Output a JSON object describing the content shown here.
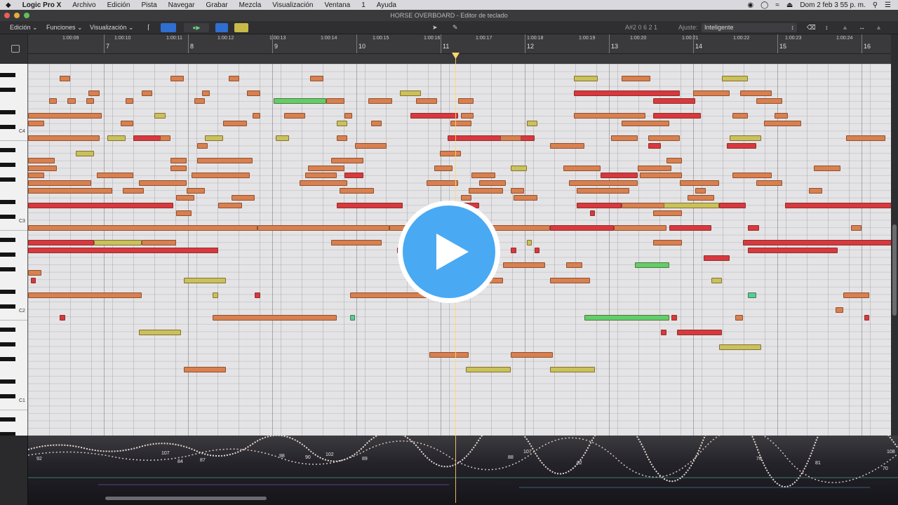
{
  "menubar": {
    "apple": "",
    "app": "Logic Pro X",
    "items": [
      "Archivo",
      "Edición",
      "Pista",
      "Navegar",
      "Grabar",
      "Mezcla",
      "Visualización",
      "Ventana",
      "1",
      "Ayuda"
    ],
    "datetime": "Dom 2 feb  3 55 p. m."
  },
  "window": {
    "title": "HORSE OVERBOARD - Editor de teclado"
  },
  "toolbar": {
    "edit_menu": "Edición",
    "functions_menu": "Funciones",
    "view_menu": "Visualización",
    "position": "A#2  0 6 2 1",
    "snap_label": "Ajuste:",
    "snap_value": "Inteligente"
  },
  "ruler": {
    "bars": [
      7,
      8,
      9,
      10,
      11,
      12,
      13,
      14,
      15,
      16
    ],
    "times": [
      "1:00:09",
      "1:00:10",
      "1:00:11",
      "1:00:12",
      "1:00:13",
      "1:00:14",
      "1:00:15",
      "1:00:16",
      "1:00:17",
      "1:00:18",
      "1:00:19",
      "1:00:20",
      "1:00:21",
      "1:00:22",
      "1:00:23",
      "1:00:24"
    ]
  },
  "keyboard": {
    "octaves": [
      "C4",
      "C3",
      "C2",
      "C1"
    ]
  },
  "velocity": {
    "numbers": [
      "92",
      "107",
      "84",
      "87",
      "98",
      "90",
      "102",
      "89",
      "88",
      "107",
      "82",
      "76",
      "70",
      "81",
      "108"
    ]
  },
  "colors": {
    "red": "#d8383f",
    "orange": "#d88050",
    "yellow": "#c8c25a",
    "green": "#5fcf6a",
    "teal": "#4fcf9a",
    "playhead": "#ffd86b",
    "play_button": "#4aa9f3"
  },
  "notes": [
    {
      "s": 1.2,
      "l": 0.4,
      "p": 0,
      "c": "orange"
    },
    {
      "s": 5.4,
      "l": 0.5,
      "p": 0,
      "c": "orange"
    },
    {
      "s": 7.6,
      "l": 0.4,
      "p": 0,
      "c": "orange"
    },
    {
      "s": 10.7,
      "l": 0.5,
      "p": 0,
      "c": "orange"
    },
    {
      "s": 20.7,
      "l": 0.9,
      "p": 0,
      "c": "yellow"
    },
    {
      "s": 22.5,
      "l": 1.1,
      "p": 0,
      "c": "orange"
    },
    {
      "s": 26.3,
      "l": 1.0,
      "p": 0,
      "c": "yellow"
    },
    {
      "s": 2.3,
      "l": 0.4,
      "p": 2,
      "c": "orange"
    },
    {
      "s": 4.3,
      "l": 0.4,
      "p": 2,
      "c": "orange"
    },
    {
      "s": 6.6,
      "l": 0.3,
      "p": 2,
      "c": "orange"
    },
    {
      "s": 8.3,
      "l": 0.5,
      "p": 2,
      "c": "orange"
    },
    {
      "s": 14.1,
      "l": 0.8,
      "p": 2,
      "c": "yellow"
    },
    {
      "s": 20.7,
      "l": 4.0,
      "p": 2,
      "c": "red"
    },
    {
      "s": 25.2,
      "l": 1.4,
      "p": 2,
      "c": "orange"
    },
    {
      "s": 27.0,
      "l": 1.2,
      "p": 2,
      "c": "orange"
    },
    {
      "s": 0.8,
      "l": 0.3,
      "p": 3,
      "c": "orange"
    },
    {
      "s": 1.5,
      "l": 0.3,
      "p": 3,
      "c": "orange"
    },
    {
      "s": 2.2,
      "l": 0.3,
      "p": 3,
      "c": "orange"
    },
    {
      "s": 3.7,
      "l": 0.3,
      "p": 3,
      "c": "orange"
    },
    {
      "s": 6.3,
      "l": 0.4,
      "p": 3,
      "c": "orange"
    },
    {
      "s": 9.3,
      "l": 2.0,
      "p": 3,
      "c": "green"
    },
    {
      "s": 11.3,
      "l": 0.7,
      "p": 3,
      "c": "orange"
    },
    {
      "s": 12.9,
      "l": 0.9,
      "p": 3,
      "c": "orange"
    },
    {
      "s": 14.7,
      "l": 0.8,
      "p": 3,
      "c": "orange"
    },
    {
      "s": 16.3,
      "l": 0.6,
      "p": 3,
      "c": "orange"
    },
    {
      "s": 23.7,
      "l": 1.6,
      "p": 3,
      "c": "red"
    },
    {
      "s": 27.6,
      "l": 1.0,
      "p": 3,
      "c": "orange"
    },
    {
      "s": 0.0,
      "l": 2.8,
      "p": 5,
      "c": "orange"
    },
    {
      "s": 4.8,
      "l": 0.4,
      "p": 5,
      "c": "yellow"
    },
    {
      "s": 8.5,
      "l": 0.3,
      "p": 5,
      "c": "orange"
    },
    {
      "s": 9.7,
      "l": 0.8,
      "p": 5,
      "c": "orange"
    },
    {
      "s": 12.0,
      "l": 0.3,
      "p": 5,
      "c": "orange"
    },
    {
      "s": 14.5,
      "l": 1.8,
      "p": 5,
      "c": "red"
    },
    {
      "s": 16.4,
      "l": 0.5,
      "p": 5,
      "c": "orange"
    },
    {
      "s": 20.7,
      "l": 2.7,
      "p": 5,
      "c": "orange"
    },
    {
      "s": 23.7,
      "l": 1.8,
      "p": 5,
      "c": "red"
    },
    {
      "s": 26.7,
      "l": 0.6,
      "p": 5,
      "c": "orange"
    },
    {
      "s": 28.3,
      "l": 0.5,
      "p": 5,
      "c": "orange"
    },
    {
      "s": 0.0,
      "l": 0.6,
      "p": 6,
      "c": "orange"
    },
    {
      "s": 3.5,
      "l": 0.5,
      "p": 6,
      "c": "orange"
    },
    {
      "s": 7.4,
      "l": 0.9,
      "p": 6,
      "c": "orange"
    },
    {
      "s": 11.7,
      "l": 0.4,
      "p": 6,
      "c": "yellow"
    },
    {
      "s": 13.0,
      "l": 0.4,
      "p": 6,
      "c": "orange"
    },
    {
      "s": 16.0,
      "l": 0.8,
      "p": 6,
      "c": "orange"
    },
    {
      "s": 18.9,
      "l": 0.4,
      "p": 6,
      "c": "yellow"
    },
    {
      "s": 22.5,
      "l": 1.8,
      "p": 6,
      "c": "orange"
    },
    {
      "s": 27.9,
      "l": 1.4,
      "p": 6,
      "c": "orange"
    },
    {
      "s": 0.0,
      "l": 2.7,
      "p": 8,
      "c": "orange"
    },
    {
      "s": 3.0,
      "l": 0.7,
      "p": 8,
      "c": "yellow"
    },
    {
      "s": 4.0,
      "l": 1.3,
      "p": 8,
      "c": "red"
    },
    {
      "s": 5.0,
      "l": 0.4,
      "p": 8,
      "c": "orange"
    },
    {
      "s": 6.7,
      "l": 0.7,
      "p": 8,
      "c": "yellow"
    },
    {
      "s": 9.4,
      "l": 0.5,
      "p": 8,
      "c": "yellow"
    },
    {
      "s": 11.7,
      "l": 0.4,
      "p": 8,
      "c": "orange"
    },
    {
      "s": 15.9,
      "l": 3.3,
      "p": 8,
      "c": "red"
    },
    {
      "s": 17.9,
      "l": 0.8,
      "p": 8,
      "c": "orange"
    },
    {
      "s": 22.1,
      "l": 1.0,
      "p": 8,
      "c": "orange"
    },
    {
      "s": 23.5,
      "l": 1.2,
      "p": 8,
      "c": "orange"
    },
    {
      "s": 26.6,
      "l": 1.2,
      "p": 8,
      "c": "yellow"
    },
    {
      "s": 31.0,
      "l": 1.5,
      "p": 8,
      "c": "orange"
    },
    {
      "s": 6.4,
      "l": 0.4,
      "p": 9,
      "c": "orange"
    },
    {
      "s": 12.4,
      "l": 1.2,
      "p": 9,
      "c": "orange"
    },
    {
      "s": 19.8,
      "l": 1.3,
      "p": 9,
      "c": "orange"
    },
    {
      "s": 23.5,
      "l": 0.5,
      "p": 9,
      "c": "red"
    },
    {
      "s": 26.5,
      "l": 1.1,
      "p": 9,
      "c": "red"
    },
    {
      "s": 1.8,
      "l": 0.7,
      "p": 10,
      "c": "yellow"
    },
    {
      "s": 15.6,
      "l": 0.8,
      "p": 10,
      "c": "orange"
    },
    {
      "s": 0.0,
      "l": 1.0,
      "p": 11,
      "c": "orange"
    },
    {
      "s": 5.4,
      "l": 0.6,
      "p": 11,
      "c": "orange"
    },
    {
      "s": 6.4,
      "l": 2.1,
      "p": 11,
      "c": "orange"
    },
    {
      "s": 11.5,
      "l": 1.2,
      "p": 11,
      "c": "orange"
    },
    {
      "s": 24.2,
      "l": 0.6,
      "p": 11,
      "c": "orange"
    },
    {
      "s": 0.0,
      "l": 1.1,
      "p": 12,
      "c": "orange"
    },
    {
      "s": 5.4,
      "l": 0.6,
      "p": 12,
      "c": "orange"
    },
    {
      "s": 10.6,
      "l": 1.4,
      "p": 12,
      "c": "orange"
    },
    {
      "s": 15.4,
      "l": 0.7,
      "p": 12,
      "c": "orange"
    },
    {
      "s": 18.3,
      "l": 0.6,
      "p": 12,
      "c": "yellow"
    },
    {
      "s": 20.3,
      "l": 1.4,
      "p": 12,
      "c": "orange"
    },
    {
      "s": 23.1,
      "l": 1.3,
      "p": 12,
      "c": "orange"
    },
    {
      "s": 29.8,
      "l": 1.0,
      "p": 12,
      "c": "orange"
    },
    {
      "s": 0.0,
      "l": 0.6,
      "p": 13,
      "c": "orange"
    },
    {
      "s": 2.6,
      "l": 1.4,
      "p": 13,
      "c": "orange"
    },
    {
      "s": 6.2,
      "l": 2.2,
      "p": 13,
      "c": "orange"
    },
    {
      "s": 10.5,
      "l": 1.2,
      "p": 13,
      "c": "orange"
    },
    {
      "s": 12.0,
      "l": 0.7,
      "p": 13,
      "c": "red"
    },
    {
      "s": 16.8,
      "l": 0.9,
      "p": 13,
      "c": "orange"
    },
    {
      "s": 21.7,
      "l": 1.4,
      "p": 13,
      "c": "red"
    },
    {
      "s": 23.2,
      "l": 1.6,
      "p": 13,
      "c": "orange"
    },
    {
      "s": 26.7,
      "l": 1.5,
      "p": 13,
      "c": "orange"
    },
    {
      "s": 0.0,
      "l": 2.4,
      "p": 14,
      "c": "orange"
    },
    {
      "s": 4.2,
      "l": 1.8,
      "p": 14,
      "c": "orange"
    },
    {
      "s": 10.3,
      "l": 1.8,
      "p": 14,
      "c": "orange"
    },
    {
      "s": 15.1,
      "l": 1.2,
      "p": 14,
      "c": "orange"
    },
    {
      "s": 17.1,
      "l": 1.0,
      "p": 14,
      "c": "orange"
    },
    {
      "s": 20.5,
      "l": 2.6,
      "p": 14,
      "c": "orange"
    },
    {
      "s": 24.7,
      "l": 1.5,
      "p": 14,
      "c": "orange"
    },
    {
      "s": 27.6,
      "l": 1.0,
      "p": 14,
      "c": "orange"
    },
    {
      "s": 0.0,
      "l": 3.2,
      "p": 15,
      "c": "orange"
    },
    {
      "s": 3.6,
      "l": 0.8,
      "p": 15,
      "c": "orange"
    },
    {
      "s": 6.0,
      "l": 0.7,
      "p": 15,
      "c": "orange"
    },
    {
      "s": 11.8,
      "l": 1.3,
      "p": 15,
      "c": "orange"
    },
    {
      "s": 16.7,
      "l": 1.3,
      "p": 15,
      "c": "orange"
    },
    {
      "s": 18.3,
      "l": 0.5,
      "p": 15,
      "c": "orange"
    },
    {
      "s": 20.8,
      "l": 2.0,
      "p": 15,
      "c": "orange"
    },
    {
      "s": 25.3,
      "l": 0.4,
      "p": 15,
      "c": "orange"
    },
    {
      "s": 29.6,
      "l": 0.5,
      "p": 15,
      "c": "orange"
    },
    {
      "s": 5.6,
      "l": 0.7,
      "p": 16,
      "c": "orange"
    },
    {
      "s": 7.7,
      "l": 0.9,
      "p": 16,
      "c": "orange"
    },
    {
      "s": 16.4,
      "l": 0.4,
      "p": 16,
      "c": "orange"
    },
    {
      "s": 18.4,
      "l": 0.9,
      "p": 16,
      "c": "orange"
    },
    {
      "s": 25.0,
      "l": 1.0,
      "p": 16,
      "c": "orange"
    },
    {
      "s": 0.0,
      "l": 5.5,
      "p": 17,
      "c": "red"
    },
    {
      "s": 7.2,
      "l": 0.9,
      "p": 17,
      "c": "orange"
    },
    {
      "s": 11.7,
      "l": 2.5,
      "p": 17,
      "c": "red"
    },
    {
      "s": 15.8,
      "l": 1.3,
      "p": 17,
      "c": "red"
    },
    {
      "s": 20.8,
      "l": 1.7,
      "p": 17,
      "c": "red"
    },
    {
      "s": 22.5,
      "l": 1.8,
      "p": 17,
      "c": "orange"
    },
    {
      "s": 24.1,
      "l": 2.1,
      "p": 17,
      "c": "yellow"
    },
    {
      "s": 26.2,
      "l": 1.0,
      "p": 17,
      "c": "red"
    },
    {
      "s": 28.7,
      "l": 4.2,
      "p": 17,
      "c": "red"
    },
    {
      "s": 5.6,
      "l": 0.6,
      "p": 18,
      "c": "orange"
    },
    {
      "s": 21.3,
      "l": 0.2,
      "p": 18,
      "c": "red"
    },
    {
      "s": 23.7,
      "l": 1.1,
      "p": 18,
      "c": "orange"
    },
    {
      "s": 0.0,
      "l": 8.7,
      "p": 20,
      "c": "orange"
    },
    {
      "s": 8.7,
      "l": 5.0,
      "p": 20,
      "c": "orange"
    },
    {
      "s": 13.7,
      "l": 6.1,
      "p": 20,
      "c": "orange"
    },
    {
      "s": 19.8,
      "l": 2.4,
      "p": 20,
      "c": "red"
    },
    {
      "s": 22.2,
      "l": 2.0,
      "p": 20,
      "c": "orange"
    },
    {
      "s": 24.3,
      "l": 1.6,
      "p": 20,
      "c": "red"
    },
    {
      "s": 27.3,
      "l": 0.4,
      "p": 20,
      "c": "red"
    },
    {
      "s": 31.2,
      "l": 0.4,
      "p": 20,
      "c": "orange"
    },
    {
      "s": 0.0,
      "l": 2.5,
      "p": 22,
      "c": "red"
    },
    {
      "s": 2.5,
      "l": 1.8,
      "p": 22,
      "c": "yellow"
    },
    {
      "s": 4.3,
      "l": 1.3,
      "p": 22,
      "c": "orange"
    },
    {
      "s": 11.5,
      "l": 1.9,
      "p": 22,
      "c": "orange"
    },
    {
      "s": 18.9,
      "l": 0.2,
      "p": 22,
      "c": "yellow"
    },
    {
      "s": 23.7,
      "l": 1.1,
      "p": 22,
      "c": "orange"
    },
    {
      "s": 27.1,
      "l": 5.9,
      "p": 22,
      "c": "red"
    },
    {
      "s": 0.0,
      "l": 7.2,
      "p": 23,
      "c": "red"
    },
    {
      "s": 14.0,
      "l": 0.2,
      "p": 23,
      "c": "red"
    },
    {
      "s": 15.3,
      "l": 0.2,
      "p": 23,
      "c": "red"
    },
    {
      "s": 18.3,
      "l": 0.2,
      "p": 23,
      "c": "red"
    },
    {
      "s": 19.2,
      "l": 0.2,
      "p": 23,
      "c": "red"
    },
    {
      "s": 27.3,
      "l": 3.4,
      "p": 23,
      "c": "red"
    },
    {
      "s": 25.6,
      "l": 1.0,
      "p": 24,
      "c": "red"
    },
    {
      "s": 14.7,
      "l": 1.3,
      "p": 25,
      "c": "yellow"
    },
    {
      "s": 16.2,
      "l": 1.1,
      "p": 25,
      "c": "orange"
    },
    {
      "s": 18.0,
      "l": 1.6,
      "p": 25,
      "c": "orange"
    },
    {
      "s": 20.4,
      "l": 0.6,
      "p": 25,
      "c": "orange"
    },
    {
      "s": 23.0,
      "l": 1.3,
      "p": 25,
      "c": "green"
    },
    {
      "s": 0.0,
      "l": 0.5,
      "p": 26,
      "c": "orange"
    },
    {
      "s": 0.1,
      "l": 0.2,
      "p": 27,
      "c": "red"
    },
    {
      "s": 5.9,
      "l": 1.6,
      "p": 27,
      "c": "yellow"
    },
    {
      "s": 14.5,
      "l": 0.2,
      "p": 27,
      "c": "teal"
    },
    {
      "s": 16.3,
      "l": 1.7,
      "p": 27,
      "c": "orange"
    },
    {
      "s": 19.8,
      "l": 1.5,
      "p": 27,
      "c": "orange"
    },
    {
      "s": 25.9,
      "l": 0.4,
      "p": 27,
      "c": "yellow"
    },
    {
      "s": 0.0,
      "l": 4.3,
      "p": 29,
      "c": "orange"
    },
    {
      "s": 7.0,
      "l": 0.2,
      "p": 29,
      "c": "yellow"
    },
    {
      "s": 8.6,
      "l": 0.2,
      "p": 29,
      "c": "red"
    },
    {
      "s": 12.2,
      "l": 3.1,
      "p": 29,
      "c": "orange"
    },
    {
      "s": 27.3,
      "l": 0.3,
      "p": 29,
      "c": "teal"
    },
    {
      "s": 30.9,
      "l": 1.0,
      "p": 29,
      "c": "orange"
    },
    {
      "s": 1.2,
      "l": 0.2,
      "p": 32,
      "c": "red"
    },
    {
      "s": 7.0,
      "l": 4.7,
      "p": 32,
      "c": "orange"
    },
    {
      "s": 12.2,
      "l": 0.2,
      "p": 32,
      "c": "teal"
    },
    {
      "s": 21.1,
      "l": 3.2,
      "p": 32,
      "c": "green"
    },
    {
      "s": 24.4,
      "l": 0.2,
      "p": 32,
      "c": "red"
    },
    {
      "s": 26.8,
      "l": 0.3,
      "p": 32,
      "c": "orange"
    },
    {
      "s": 30.6,
      "l": 0.3,
      "p": 31,
      "c": "orange"
    },
    {
      "s": 31.7,
      "l": 0.2,
      "p": 32,
      "c": "red"
    },
    {
      "s": 4.2,
      "l": 1.6,
      "p": 34,
      "c": "yellow"
    },
    {
      "s": 24.0,
      "l": 0.2,
      "p": 34,
      "c": "red"
    },
    {
      "s": 24.6,
      "l": 1.7,
      "p": 34,
      "c": "red"
    },
    {
      "s": 26.2,
      "l": 1.6,
      "p": 36,
      "c": "yellow"
    },
    {
      "s": 15.2,
      "l": 1.5,
      "p": 37,
      "c": "orange"
    },
    {
      "s": 18.3,
      "l": 1.6,
      "p": 37,
      "c": "orange"
    },
    {
      "s": 5.9,
      "l": 1.6,
      "p": 39,
      "c": "orange"
    },
    {
      "s": 16.6,
      "l": 1.7,
      "p": 39,
      "c": "yellow"
    },
    {
      "s": 19.8,
      "l": 1.7,
      "p": 39,
      "c": "yellow"
    }
  ]
}
